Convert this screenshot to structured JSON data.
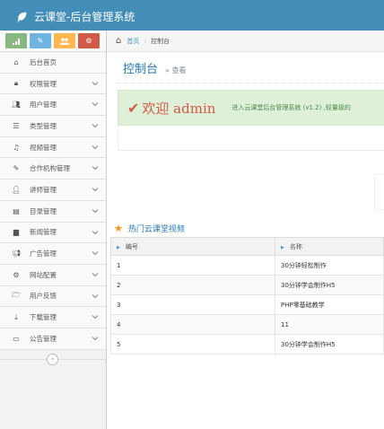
{
  "app": {
    "title": "云课堂-后台管理系统"
  },
  "shortcuts": [
    {
      "icon": "signal-icon",
      "color": "#87b87f"
    },
    {
      "icon": "pencil-icon",
      "color": "#6fb3e0"
    },
    {
      "icon": "users-icon",
      "color": "#ffb752"
    },
    {
      "icon": "cogs-icon",
      "color": "#d15b47"
    }
  ],
  "sidebar": {
    "items": [
      {
        "label": "后台首页",
        "icon": "home-icon"
      },
      {
        "label": "权限管理",
        "icon": "lock-icon"
      },
      {
        "label": "用户管理",
        "icon": "users-icon"
      },
      {
        "label": "类型管理",
        "icon": "list-icon"
      },
      {
        "label": "视频管理",
        "icon": "music-icon"
      },
      {
        "label": "合作机构管理",
        "icon": "edit-icon"
      },
      {
        "label": "讲师管理",
        "icon": "user-icon"
      },
      {
        "label": "目录管理",
        "icon": "list-alt-icon"
      },
      {
        "label": "新闻管理",
        "icon": "book-icon"
      },
      {
        "label": "广告管理",
        "icon": "bullhorn-icon"
      },
      {
        "label": "网站配置",
        "icon": "cogs-icon"
      },
      {
        "label": "用户反馈",
        "icon": "folder-open-icon"
      },
      {
        "label": "下载管理",
        "icon": "download-icon"
      },
      {
        "label": "公告管理",
        "icon": "credit-card-icon"
      }
    ]
  },
  "breadcrumb": {
    "home": "首页",
    "current": "控制台"
  },
  "page": {
    "title": "控制台",
    "subtitle": "查看"
  },
  "alert": {
    "welcome": "欢迎 admin",
    "message": "进入云课堂后台管理系统 (v1.2) ,轻量级的"
  },
  "section": {
    "title": "热门云课堂视频"
  },
  "table": {
    "headers": [
      "编号",
      "名称"
    ],
    "rows": [
      [
        "1",
        "30分钟轻松制作"
      ],
      [
        "2",
        "30分钟学会制作H5"
      ],
      [
        "3",
        "PHP零基础教学"
      ],
      [
        "4",
        "11"
      ],
      [
        "5",
        "30分钟学会制作H5"
      ]
    ]
  },
  "colors": {
    "navbar": "#438eb9",
    "title": "#2679b5",
    "alert_bg": "#dff0d8",
    "welcome": "#d15b47"
  }
}
